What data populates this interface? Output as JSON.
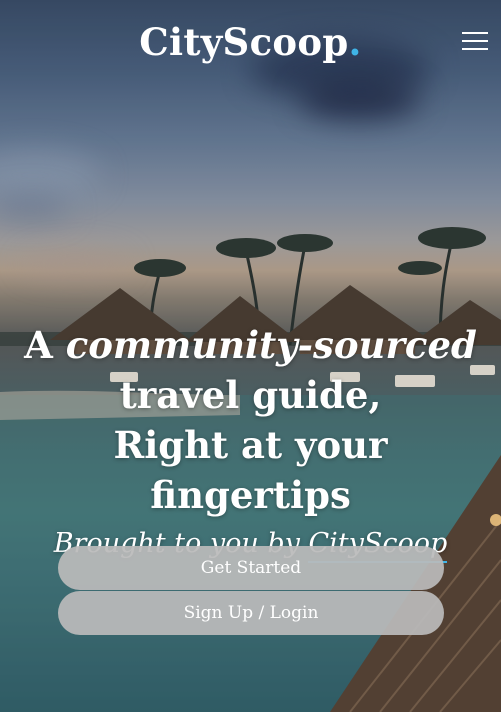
{
  "header": {
    "logo_text": "CityScoop",
    "logo_dot": ".",
    "menu_icon": "hamburger-menu-icon"
  },
  "hero": {
    "line1_pre": "A ",
    "line1_em": "community-sourced",
    "line1_post": " travel guide,",
    "line2": "Right at your fingertips",
    "byline_pre": "Brought to you by ",
    "byline_brand": "CityScoop"
  },
  "actions": {
    "get_started": "Get Started",
    "signup_login": "Sign Up / Login"
  },
  "colors": {
    "accent": "#3fb4e6",
    "button_bg": "#bababa",
    "text": "#ffffff"
  }
}
